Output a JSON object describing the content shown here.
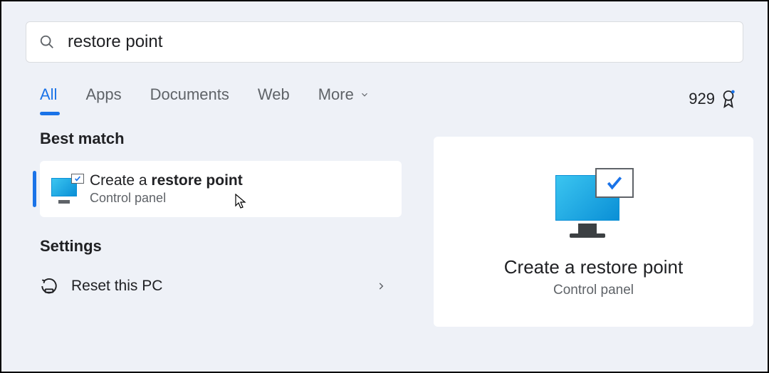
{
  "search": {
    "value": "restore point"
  },
  "tabs": {
    "all": "All",
    "apps": "Apps",
    "documents": "Documents",
    "web": "Web",
    "more": "More"
  },
  "rewards": {
    "points": "929"
  },
  "sections": {
    "best_match": "Best match",
    "settings": "Settings"
  },
  "result": {
    "title_prefix": "Create a ",
    "title_bold": "restore point",
    "subtitle": "Control panel"
  },
  "settings_items": {
    "reset_pc": "Reset this PC"
  },
  "preview": {
    "title": "Create a restore point",
    "subtitle": "Control panel"
  }
}
